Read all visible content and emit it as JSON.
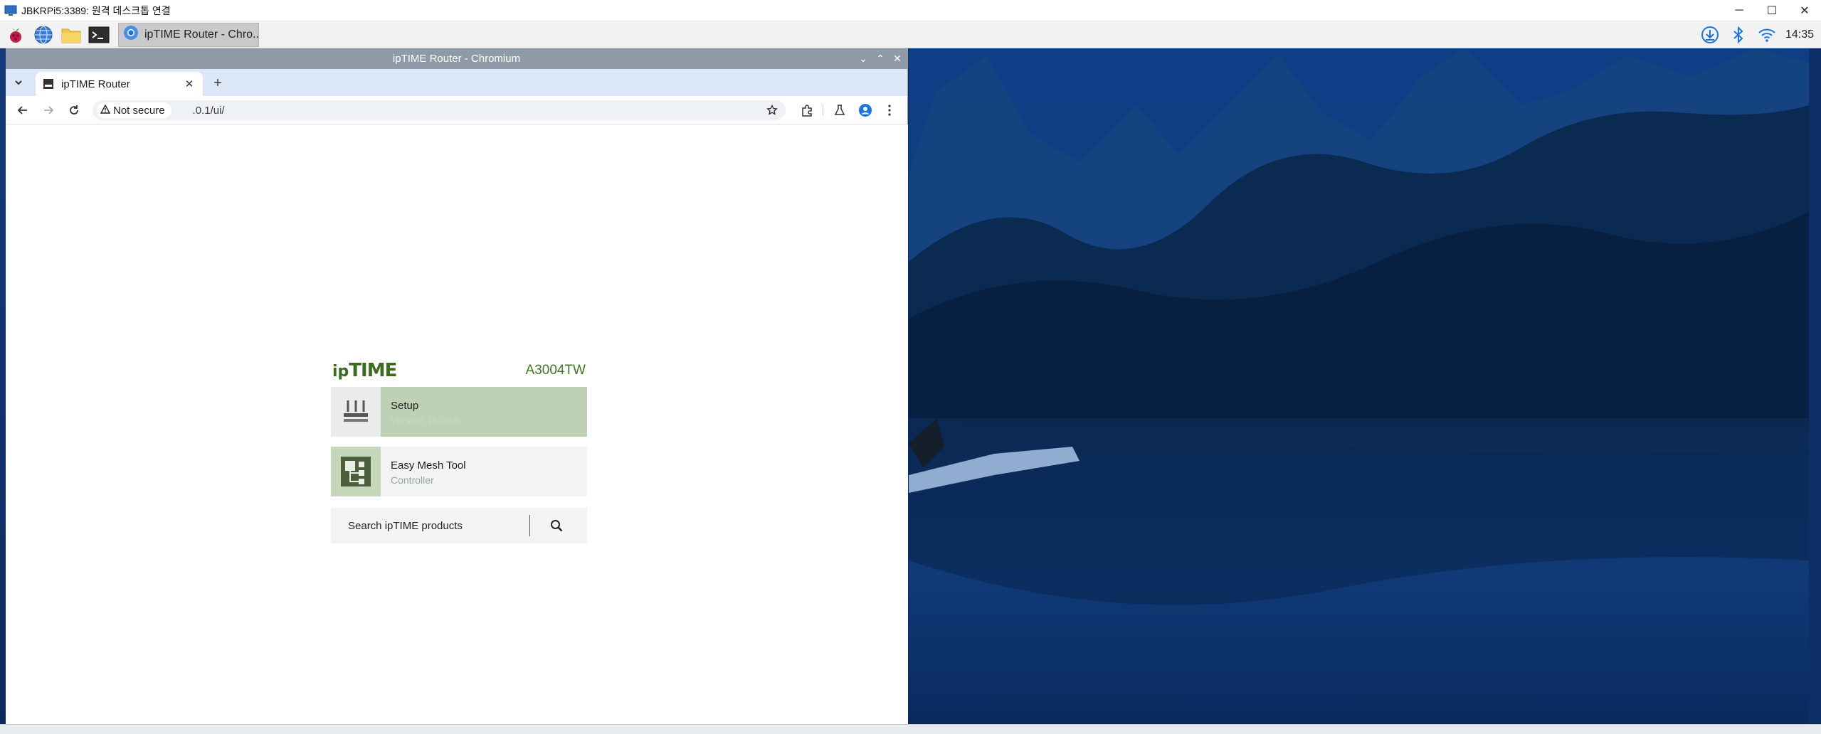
{
  "rdp": {
    "title": "JBKRPi5:3389: 원격 데스크톱 연결",
    "controls": {
      "minimize": "─",
      "maximize": "☐",
      "close": "✕"
    }
  },
  "taskbar": {
    "launchers": [
      "raspberry-menu-icon",
      "web-browser-icon",
      "file-manager-icon",
      "terminal-icon"
    ],
    "active_task_label": "ipTIME Router - Chro...",
    "tray_icons": [
      "download-icon",
      "bluetooth-icon",
      "wifi-icon"
    ],
    "clock": "14:35"
  },
  "chromium": {
    "window_title": "ipTIME Router - Chromium",
    "controls": {
      "minimize": "⌄",
      "maximize": "⌃",
      "close": "✕"
    },
    "tab": {
      "title": "ipTIME Router",
      "close": "✕"
    },
    "new_tab": "+",
    "security_label": "Not secure",
    "url": ".0.1/ui/"
  },
  "page": {
    "logo_ip": "ip",
    "logo_time": "TIME",
    "model": "A3004TW",
    "setup": {
      "title": "Setup",
      "subtitle": "Version 15.06.6"
    },
    "mesh": {
      "title": "Easy Mesh Tool",
      "subtitle": "Controller"
    },
    "search": {
      "placeholder": "Search ipTIME products"
    }
  },
  "colors": {
    "brand_green": "#3a6b1f",
    "setup_bg": "#bfd1b4",
    "mesh_bg": "#f2f4f1",
    "chromium_title_bar": "#8f9aa6",
    "tabstrip": "#dbe6f7"
  }
}
